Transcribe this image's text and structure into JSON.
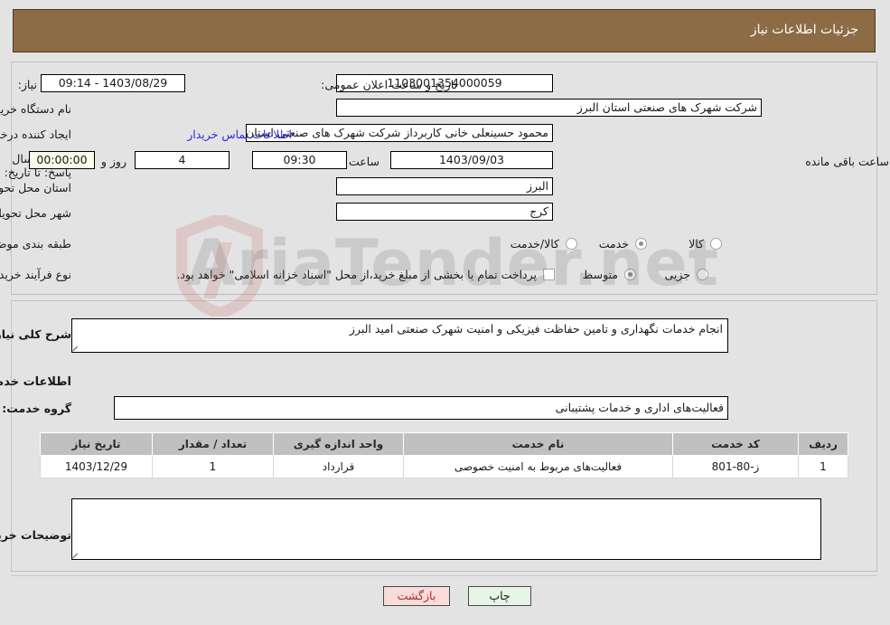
{
  "header": {
    "title": "جزئیات اطلاعات نیاز"
  },
  "top_form": {
    "need_number_label": "شماره نیاز:",
    "need_number_value": "1103001354000059",
    "announce_datetime_label": "تاریخ و ساعت اعلان عمومی:",
    "announce_datetime_value": "1403/08/29 - 09:14",
    "buyer_org_label": "نام دستگاه خریدار:",
    "buyer_org_value": "شرکت شهرک های صنعتی استان البرز",
    "requester_label": "ایجاد کننده درخواست:",
    "requester_value": "محمود حسینعلی خانی کاربرداز شرکت شهرک های صنعتی استان البرز",
    "contact_link": "اطلاعات تماس خریدار",
    "deadline_label": "مهلت ارسال پاسخ: تا تاریخ:",
    "deadline_date": "1403/09/03",
    "hour_label": "ساعت",
    "deadline_time": "09:30",
    "days_value": "4",
    "days_label": "روز و",
    "countdown_value": "00:00:00",
    "remaining_label": "ساعت باقی مانده",
    "province_label": "استان محل تحویل:",
    "province_value": "البرز",
    "city_label": "شهر محل تحویل:",
    "city_value": "کرج",
    "category_label": "طبقه بندی موضوعی:",
    "category_options": [
      {
        "label": "کالا",
        "selected": false
      },
      {
        "label": "خدمت",
        "selected": true
      },
      {
        "label": "کالا/خدمت",
        "selected": false
      }
    ],
    "process_label": "نوع فرآیند خرید :",
    "process_options": [
      {
        "label": "جزیی",
        "selected": false
      },
      {
        "label": "متوسط",
        "selected": true
      }
    ],
    "treasury_checkbox_label": "پرداخت تمام یا بخشی از مبلغ خرید،از محل \"اسناد خزانه اسلامی\" خواهد بود.",
    "treasury_checked": false
  },
  "middle": {
    "general_desc_label": "شرح کلی نیاز:",
    "general_desc_value": "انجام خدمات نگهداری و تامین حفاظت فیزیکی و امنیت شهرک صنعتی امید البرز",
    "section_heading": "اطلاعات خدمات مورد نیاز",
    "service_group_label": "گروه خدمت:",
    "service_group_value": "فعالیت‌های اداری و خدمات پشتیبانی"
  },
  "table": {
    "columns": [
      "ردیف",
      "کد خدمت",
      "نام خدمت",
      "واحد اندازه گیری",
      "تعداد / مقدار",
      "تاریخ نیاز"
    ],
    "rows": [
      {
        "row": "1",
        "service_code": "ز-80-801",
        "service_name": "فعالیت‌های مربوط به امنیت خصوصی",
        "unit": "قرارداد",
        "quantity": "1",
        "need_date": "1403/12/29"
      }
    ]
  },
  "buyer_notes": {
    "label": "توضیحات خریدار:",
    "value": ""
  },
  "footer": {
    "back_button": "بازگشت",
    "print_button": "چاپ"
  },
  "watermark": {
    "text": "AriaTender.net"
  },
  "colors": {
    "header_bg": "#8c6b45",
    "link": "#2b2bdd",
    "back_button_bg": "#fadbdb",
    "back_button_text": "#b02a2a",
    "print_button_bg": "#e6f5e6",
    "table_header_bg": "#c0c0c0",
    "countdown_bg": "#fbfbe8",
    "page_bg": "#e3e3e3"
  }
}
